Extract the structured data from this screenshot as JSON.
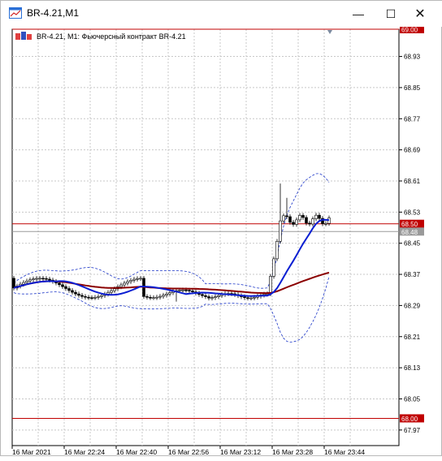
{
  "window": {
    "title": "BR-4.21,M1",
    "minimize_glyph": "—",
    "maximize_glyph": "☐",
    "close_glyph": "✕"
  },
  "chart_header": {
    "label": "BR-4.21, M1:  Фьючерсный контракт BR-4.21",
    "icon": "candlestick-chart-icon"
  },
  "chart_data": {
    "type": "line",
    "series": [],
    "y_ticks": [
      "68.93",
      "68.85",
      "68.77",
      "68.69",
      "68.61",
      "68.53",
      "68.45",
      "68.37",
      "68.29",
      "68.21",
      "68.13",
      "68.05",
      "67.97"
    ],
    "x_ticks": [
      "16 Mar 2021",
      "16 Mar 22:24",
      "16 Mar 22:40",
      "16 Mar 22:56",
      "16 Mar 23:12",
      "16 Mar 23:28",
      "16 Mar 23:44"
    ],
    "ylim": [
      67.93,
      69.0
    ],
    "grid": true,
    "price_levels": [
      {
        "value": 69.0,
        "label": "69.00",
        "color": "#c00000"
      },
      {
        "value": 68.5,
        "label": "68.50",
        "color": "#c00000"
      },
      {
        "value": 68.0,
        "label": "68.00",
        "color": "#c00000"
      }
    ],
    "current_price": {
      "value": 68.48,
      "label": "68.48",
      "color": "#9a9a9a"
    },
    "colors": {
      "candle": "#000000",
      "ma_fast": "#0a1ed2",
      "ma_slow": "#8b0000",
      "bands": "#1c36c8",
      "grid": "#c8c8c8",
      "level": "#c00000"
    }
  }
}
